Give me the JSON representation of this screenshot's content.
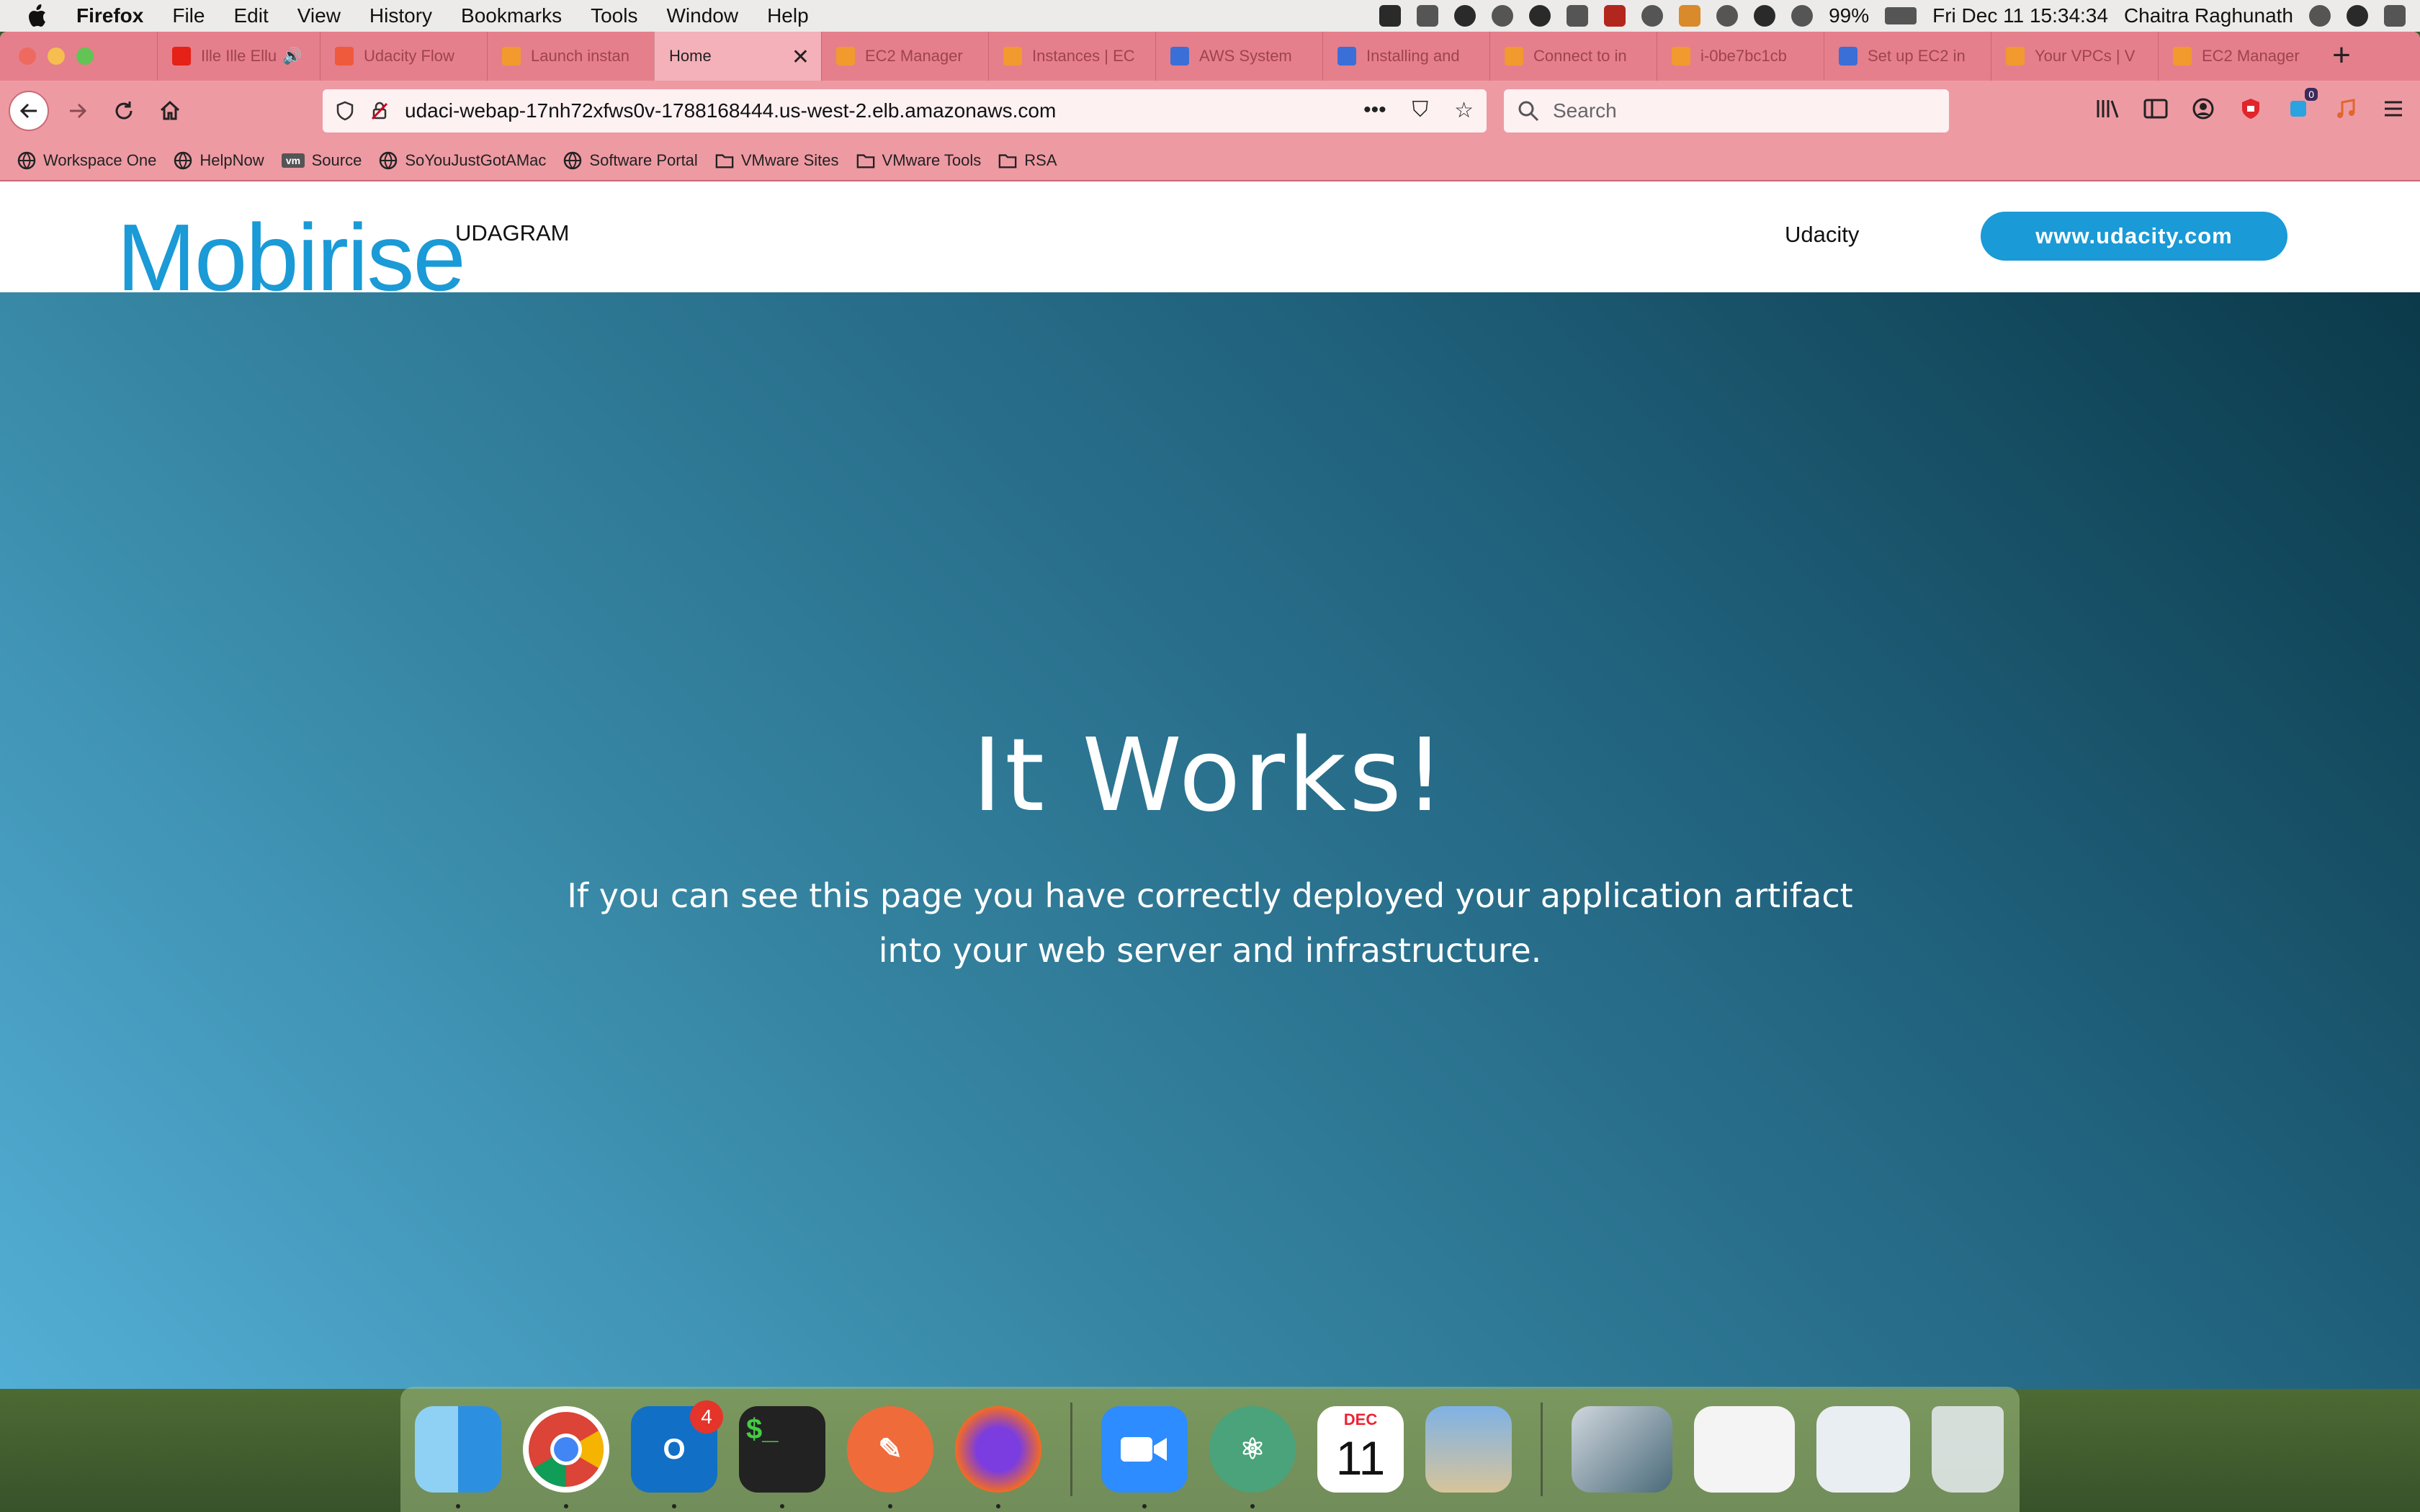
{
  "menubar": {
    "app_name": "Firefox",
    "menus": [
      "File",
      "Edit",
      "View",
      "History",
      "Bookmarks",
      "Tools",
      "Window",
      "Help"
    ],
    "battery": "99%",
    "datetime": "Fri Dec 11  15:34:34",
    "user": "Chaitra Raghunath"
  },
  "tabs": [
    {
      "label": "Ille Ille Ellu",
      "icon": "youtube-icon",
      "color": "#e62117",
      "speaker": true
    },
    {
      "label": "Udacity Flow",
      "icon": "udacity-icon",
      "color": "#ef5a3c"
    },
    {
      "label": "Launch instan",
      "icon": "aws-cube-icon",
      "color": "#f29a2e"
    },
    {
      "label": "Home",
      "icon": "none",
      "color": "#f4b1b9",
      "active": true
    },
    {
      "label": "EC2 Manager",
      "icon": "aws-cube-icon",
      "color": "#f29a2e"
    },
    {
      "label": "Instances | EC",
      "icon": "aws-cube-icon",
      "color": "#f29a2e"
    },
    {
      "label": "AWS System",
      "icon": "aws-doc-icon",
      "color": "#3a6fd8"
    },
    {
      "label": "Installing and",
      "icon": "aws-doc-icon",
      "color": "#3a6fd8"
    },
    {
      "label": "Connect to in",
      "icon": "aws-cube-icon",
      "color": "#f29a2e"
    },
    {
      "label": "i-0be7bc1cb",
      "icon": "aws-cube-icon",
      "color": "#f29a2e"
    },
    {
      "label": "Set up EC2 in",
      "icon": "aws-doc-icon",
      "color": "#3a6fd8"
    },
    {
      "label": "Your VPCs | V",
      "icon": "aws-cube-icon",
      "color": "#f29a2e"
    },
    {
      "label": "EC2 Manager",
      "icon": "aws-cube-icon",
      "color": "#f29a2e"
    }
  ],
  "toolbar": {
    "url": "udaci-webap-17nh72xfws0v-1788168444.us-west-2.elb.amazonaws.com",
    "search_placeholder": "Search",
    "extension_badge": "0"
  },
  "bookmarks": [
    {
      "label": "Workspace One",
      "icon": "globe-icon"
    },
    {
      "label": "HelpNow",
      "icon": "globe-icon"
    },
    {
      "label": "Source",
      "icon": "vm-icon"
    },
    {
      "label": "SoYouJustGotAMac",
      "icon": "globe-icon"
    },
    {
      "label": "Software Portal",
      "icon": "globe-icon"
    },
    {
      "label": "VMware Sites",
      "icon": "folder-icon"
    },
    {
      "label": "VMware Tools",
      "icon": "folder-icon"
    },
    {
      "label": "RSA",
      "icon": "folder-icon"
    }
  ],
  "site": {
    "logo": "Mobirise",
    "brand": "UDAGRAM",
    "nav_link": "Udacity",
    "cta": "www.udacity.com",
    "hero_title": "It Works!",
    "hero_text": "If you can see this page you have correctly deployed your application artifact into your web server and infrastructure.",
    "accent": "#1a9ad6"
  },
  "dock": {
    "outlook_badge": "4",
    "calendar_month": "DEC",
    "calendar_day": "11",
    "apps": [
      "finder",
      "chrome",
      "outlook",
      "terminal",
      "postman",
      "firefox",
      "zoom",
      "atom",
      "calendar",
      "preview",
      "vmware-fusion",
      "screenshot",
      "outlook-doc",
      "trash"
    ]
  }
}
